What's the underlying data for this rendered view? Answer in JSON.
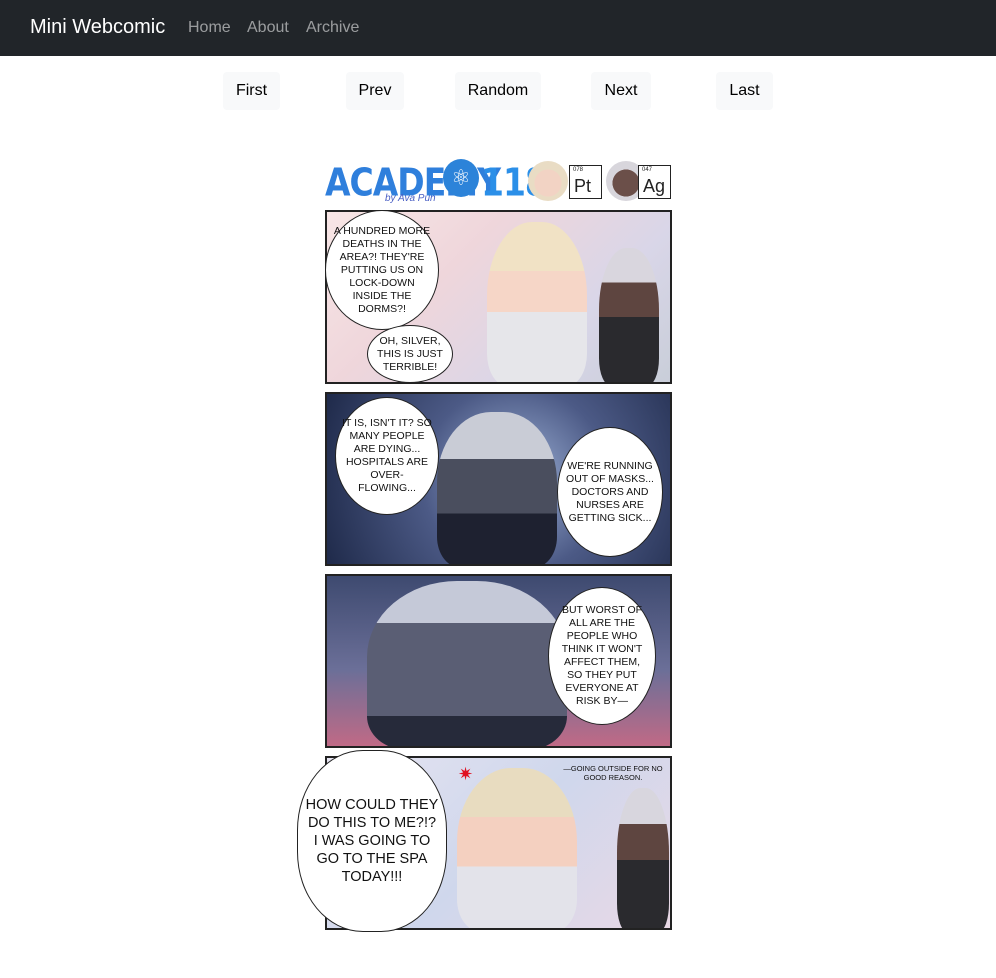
{
  "navbar": {
    "brand": "Mini Webcomic",
    "links": [
      "Home",
      "About",
      "Archive"
    ]
  },
  "pager": {
    "buttons": [
      "First",
      "Prev",
      "Random",
      "Next",
      "Last"
    ]
  },
  "comic": {
    "title": "ACADEMY",
    "title_number": "118",
    "byline": "by Ava Pun",
    "elements": [
      {
        "number": "078",
        "symbol": "Pt"
      },
      {
        "number": "047",
        "symbol": "Ag"
      }
    ],
    "panels": [
      {
        "bubbles": [
          "A HUNDRED MORE DEATHS IN THE AREA?! THEY'RE PUTTING US ON LOCK-DOWN INSIDE THE DORMS?!",
          "OH, SILVER, THIS IS JUST TERRIBLE!"
        ]
      },
      {
        "bubbles": [
          "IT IS, ISN'T IT? SO MANY PEOPLE ARE DYING... HOSPITALS ARE OVER-FLOWING...",
          "WE'RE RUNNING OUT OF MASKS... DOCTORS AND NURSES ARE GETTING SICK..."
        ]
      },
      {
        "bubbles": [
          "BUT WORST OF ALL ARE THE PEOPLE WHO THINK IT WON'T AFFECT THEM, SO THEY PUT EVERYONE AT RISK BY—"
        ]
      },
      {
        "bubbles": [
          "HOW COULD THEY DO THIS TO ME?!? I WAS GOING TO GO TO THE SPA TODAY!!!",
          "—GOING OUTSIDE FOR NO GOOD REASON."
        ]
      }
    ]
  }
}
